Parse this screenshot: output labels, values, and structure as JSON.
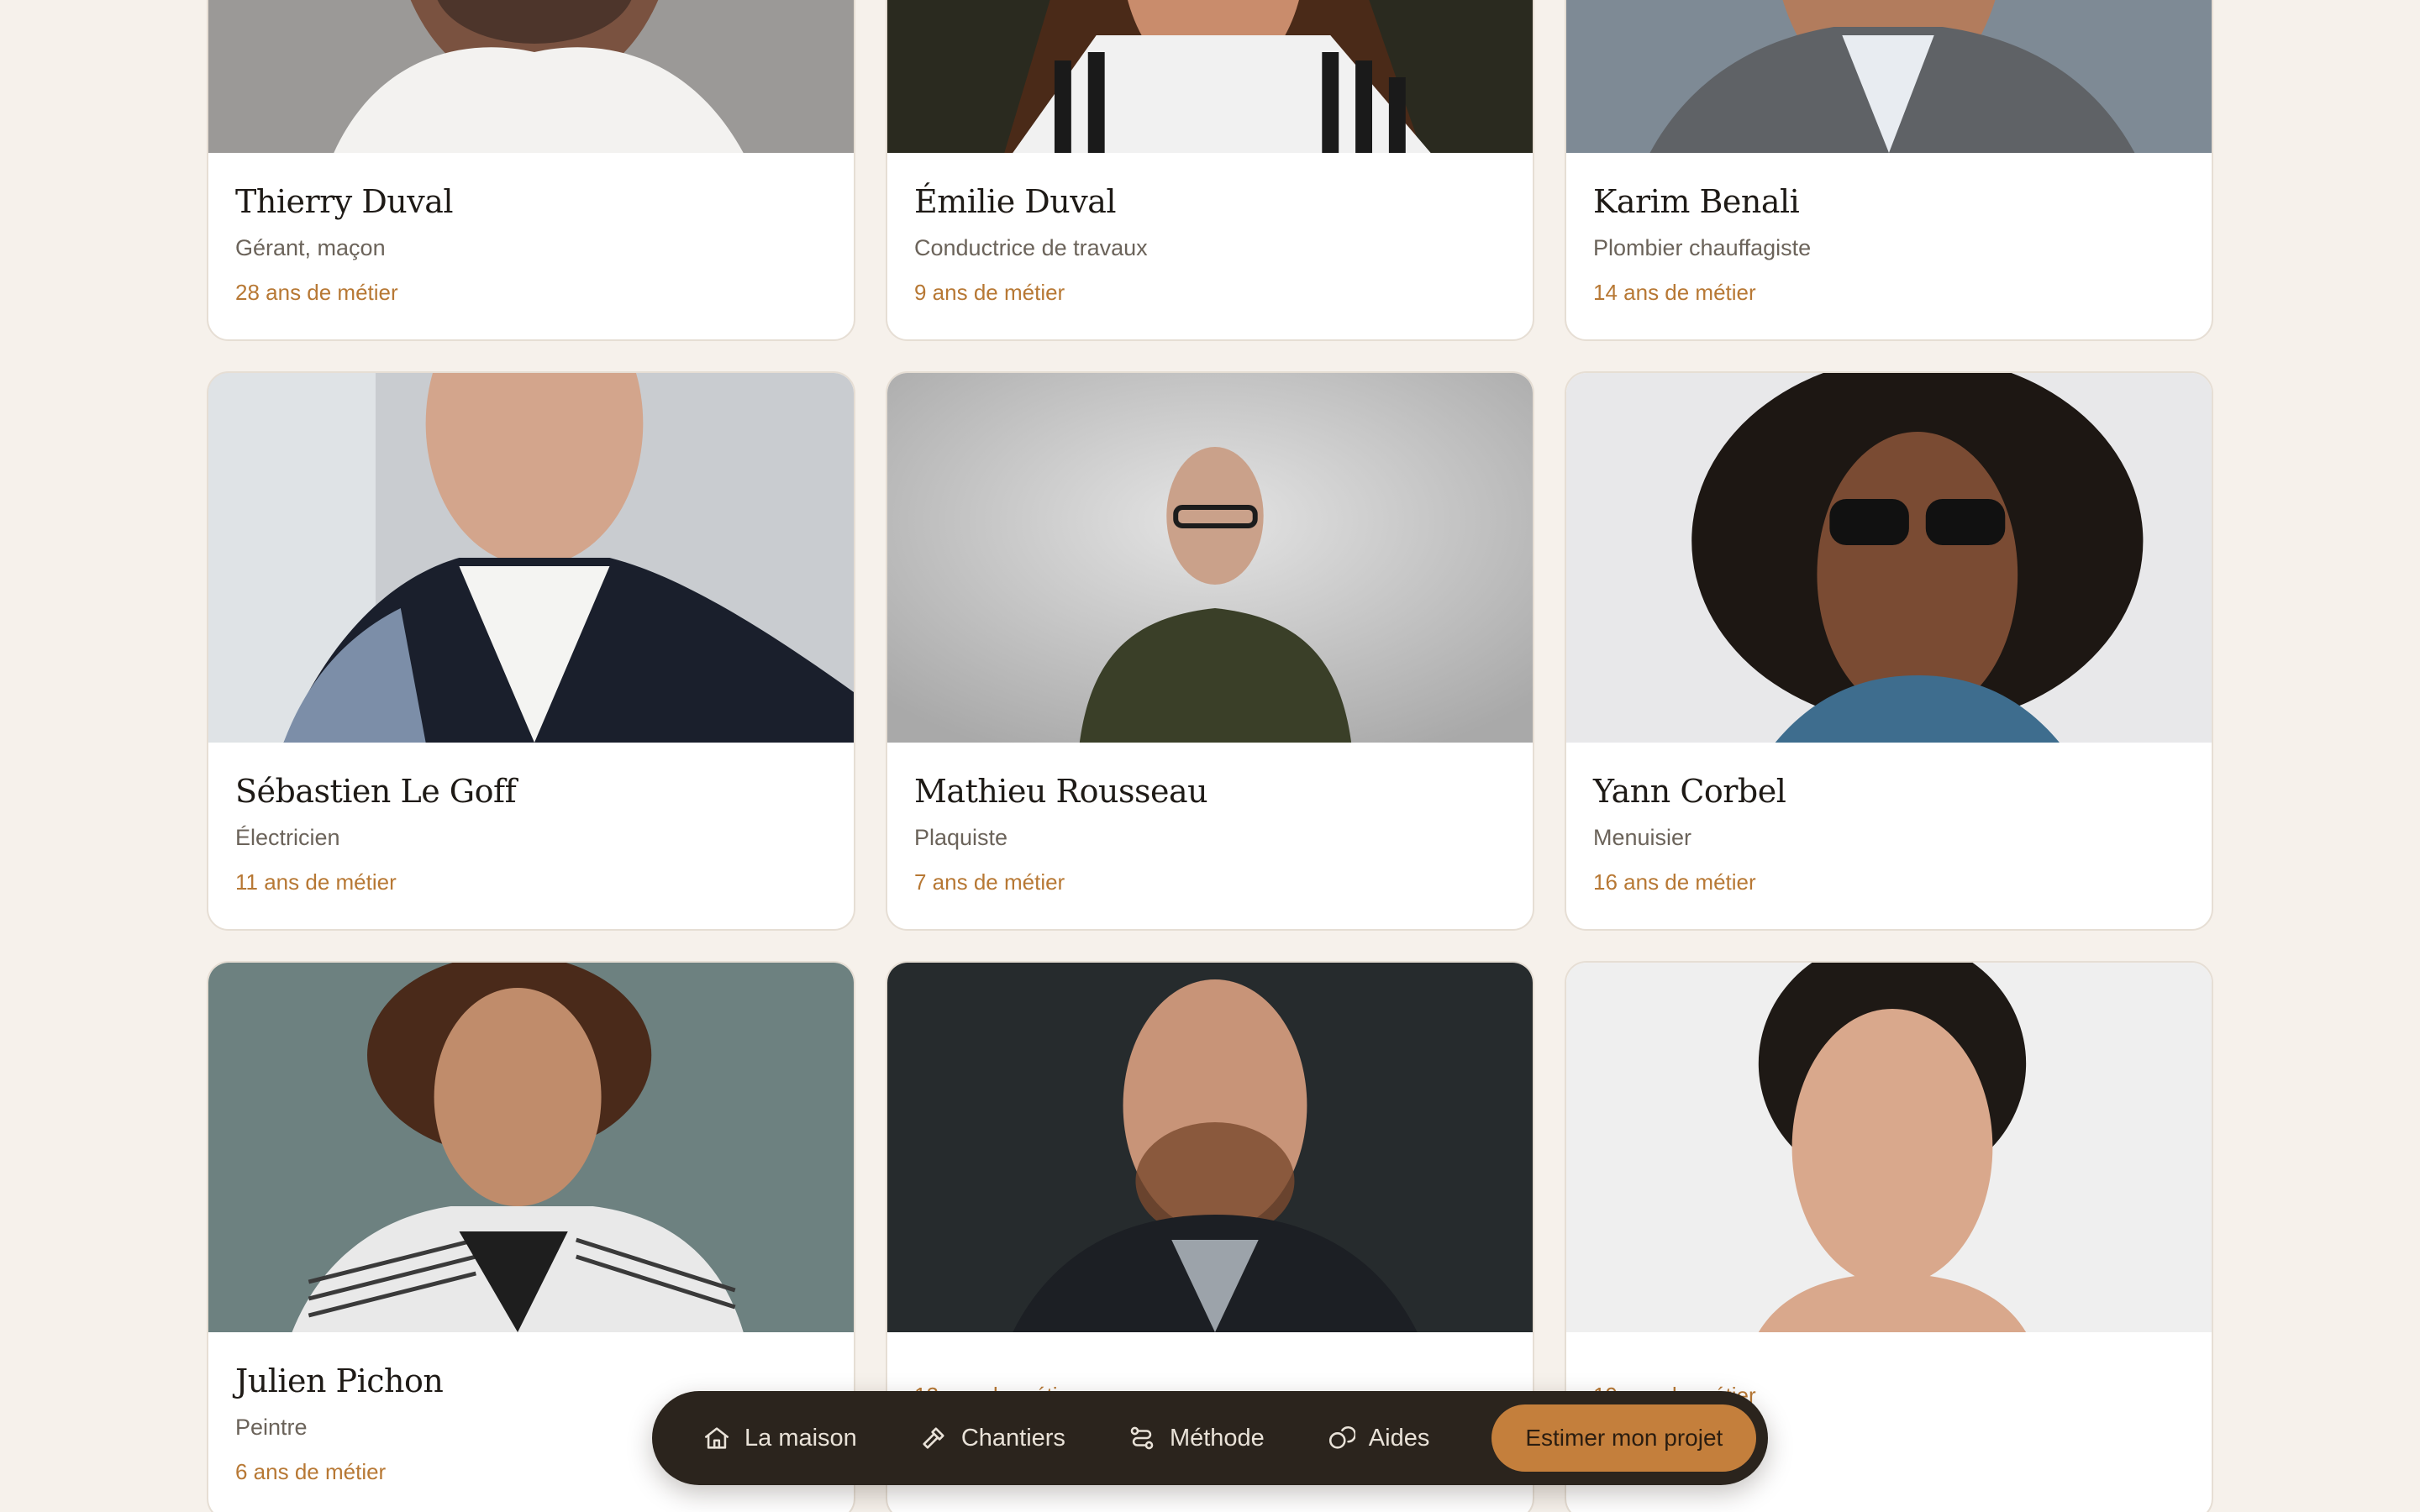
{
  "team": [
    {
      "name": "Thierry Duval",
      "role": "Gérant, maçon",
      "experience": "28 ans de métier"
    },
    {
      "name": "Émilie Duval",
      "role": "Conductrice de travaux",
      "experience": "9 ans de métier"
    },
    {
      "name": "Karim Benali",
      "role": "Plombier chauffagiste",
      "experience": "14 ans de métier"
    },
    {
      "name": "Sébastien Le Goff",
      "role": "Électricien",
      "experience": "11 ans de métier"
    },
    {
      "name": "Mathieu Rousseau",
      "role": "Plaquiste",
      "experience": "7 ans de métier"
    },
    {
      "name": "Yann Corbel",
      "role": "Menuisier",
      "experience": "16 ans de métier"
    },
    {
      "name": "Julien Pichon",
      "role": "Peintre",
      "experience": "6 ans de métier"
    },
    {
      "name": "",
      "role": "",
      "experience": "12 ans de métier"
    },
    {
      "name": "",
      "role": "",
      "experience": "19 ans de métier"
    }
  ],
  "nav": {
    "items": [
      {
        "label": "La maison",
        "icon": "home-icon"
      },
      {
        "label": "Chantiers",
        "icon": "hammer-icon"
      },
      {
        "label": "Méthode",
        "icon": "route-icon"
      },
      {
        "label": "Aides",
        "icon": "coins-icon"
      }
    ],
    "cta": "Estimer mon projet"
  },
  "colors": {
    "background": "#f6f1eb",
    "accent": "#c47f3c",
    "dock": "#2b241d",
    "experience_text": "#b77834"
  }
}
